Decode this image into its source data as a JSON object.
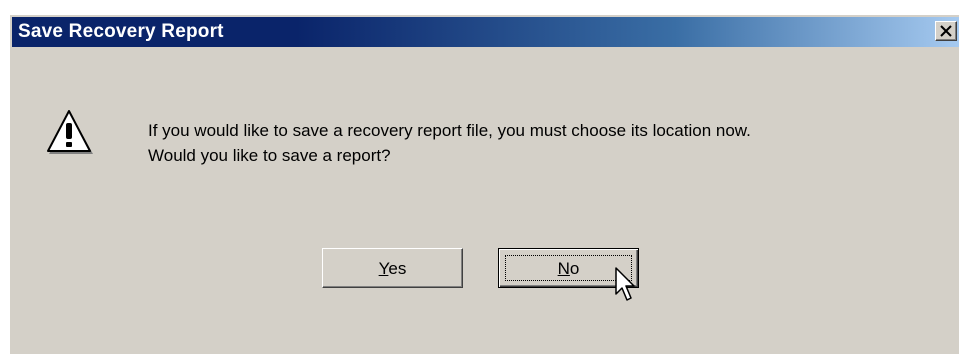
{
  "dialog": {
    "title": "Save Recovery Report",
    "message_line1": "If you would like to save a recovery report file, you must choose its location now.",
    "message_line2": "Would you like to save a report?",
    "icon": "warning-icon",
    "close_icon": "close-icon"
  },
  "buttons": {
    "yes": {
      "accel": "Y",
      "rest": "es"
    },
    "no": {
      "accel": "N",
      "rest": "o"
    }
  },
  "focused_button": "No",
  "colors": {
    "title_start": "#0a246a",
    "title_end": "#a6caf0",
    "face": "#d4d0c8"
  }
}
